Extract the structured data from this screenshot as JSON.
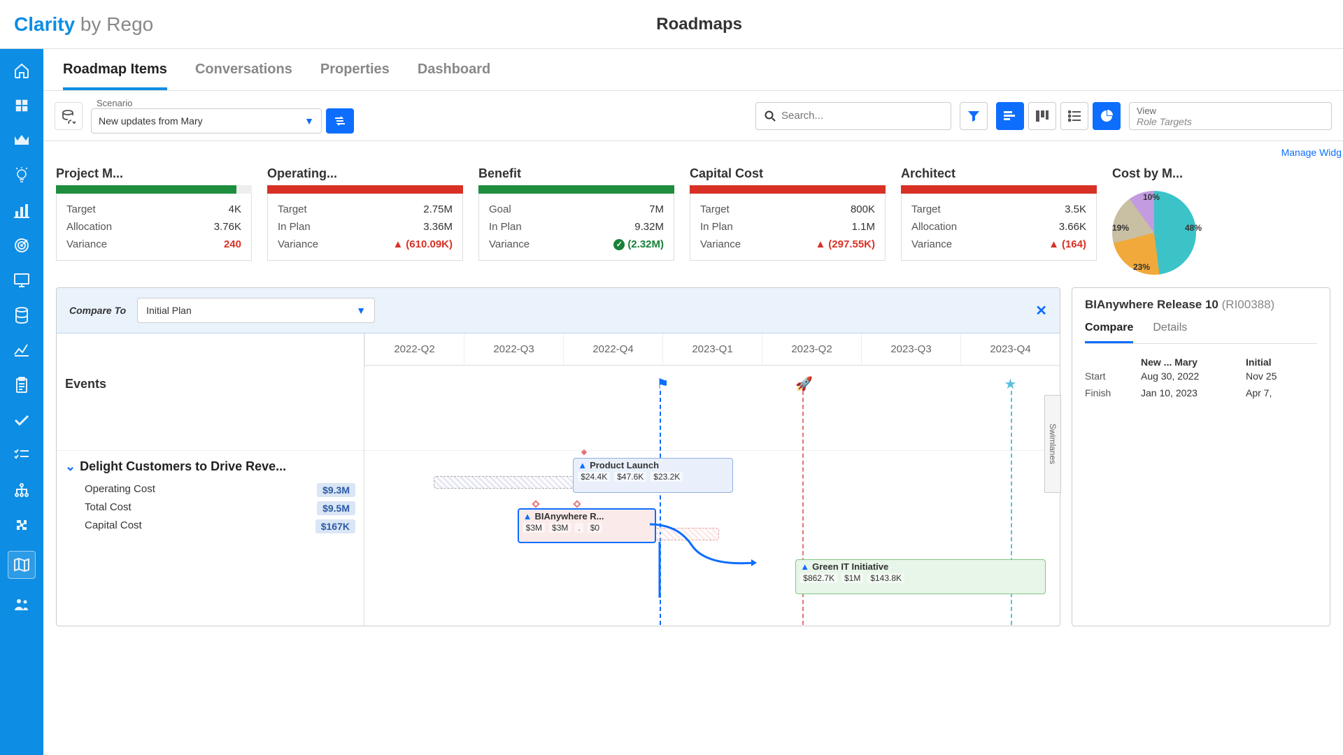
{
  "header": {
    "brand": "Clarity",
    "by": " by Rego",
    "title": "Roadmaps"
  },
  "tabs": [
    "Roadmap Items",
    "Conversations",
    "Properties",
    "Dashboard"
  ],
  "scenario": {
    "label": "Scenario",
    "value": "New updates from Mary"
  },
  "search": {
    "placeholder": "Search..."
  },
  "view": {
    "label": "View",
    "value": "Role Targets"
  },
  "widgets_link": "Manage Widg",
  "kpis": [
    {
      "title": "Project M...",
      "bar": [
        [
          "#1e8e3e",
          92
        ],
        [
          "#eee",
          8
        ]
      ],
      "lines": [
        [
          "Target",
          "4K"
        ],
        [
          "Allocation",
          "3.76K"
        ],
        [
          "Variance",
          "240"
        ]
      ],
      "var_status": "none"
    },
    {
      "title": "Operating...",
      "bar": [
        [
          "#d93025",
          100
        ]
      ],
      "lines": [
        [
          "Target",
          "2.75M"
        ],
        [
          "In Plan",
          "3.36M"
        ],
        [
          "Variance",
          "(610.09K)"
        ]
      ],
      "var_status": "bad"
    },
    {
      "title": "Benefit",
      "bar": [
        [
          "#1e8e3e",
          100
        ]
      ],
      "lines": [
        [
          "Goal",
          "7M"
        ],
        [
          "In Plan",
          "9.32M"
        ],
        [
          "Variance",
          "(2.32M)"
        ]
      ],
      "var_status": "good"
    },
    {
      "title": "Capital Cost",
      "bar": [
        [
          "#d93025",
          100
        ]
      ],
      "lines": [
        [
          "Target",
          "800K"
        ],
        [
          "In Plan",
          "1.1M"
        ],
        [
          "Variance",
          "(297.55K)"
        ]
      ],
      "var_status": "bad"
    },
    {
      "title": "Architect",
      "bar": [
        [
          "#d93025",
          100
        ]
      ],
      "lines": [
        [
          "Target",
          "3.5K"
        ],
        [
          "Allocation",
          "3.66K"
        ],
        [
          "Variance",
          "(164)"
        ]
      ],
      "var_status": "bad"
    }
  ],
  "pie": {
    "title": "Cost by M...",
    "slices": [
      {
        "l": "48%"
      },
      {
        "l": "23%"
      },
      {
        "l": "19%"
      },
      {
        "l": "10%"
      }
    ]
  },
  "compare": {
    "label": "Compare To",
    "value": "Initial Plan"
  },
  "timeline": {
    "quarters": [
      "2022-Q2",
      "2022-Q3",
      "2022-Q4",
      "2023-Q1",
      "2023-Q2",
      "2023-Q3",
      "2023-Q4"
    ],
    "events_label": "Events",
    "swimlanes": "Swimlanes"
  },
  "group": {
    "title": "Delight Customers to Drive Reve...",
    "metrics": [
      [
        "Operating Cost",
        "$9.3M"
      ],
      [
        "Total Cost",
        "$9.5M"
      ],
      [
        "Capital Cost",
        "$167K"
      ]
    ],
    "bars": {
      "product_launch": {
        "title": "Product Launch",
        "costs": [
          "$24.4K",
          "$47.6K",
          "$23.2K"
        ]
      },
      "bianywhere": {
        "title": "BIAnywhere R...",
        "costs": [
          "$3M",
          "$3M",
          "$0"
        ]
      },
      "green_it": {
        "title": "Green IT Initiative",
        "costs": [
          "$862.7K",
          "$1M",
          "$143.8K"
        ]
      }
    }
  },
  "detail": {
    "name": "BIAnywhere Release 10",
    "code": "(RI00388)",
    "tabs": [
      "Compare",
      "Details"
    ],
    "cols": [
      "New ... Mary",
      "Initial"
    ],
    "rows": [
      {
        "k": "Start",
        "a": "Aug 30, 2022",
        "b": "Nov 25"
      },
      {
        "k": "Finish",
        "a": "Jan 10, 2023",
        "b": "Apr 7,"
      }
    ]
  },
  "chart_data": {
    "type": "pie",
    "title": "Cost by M...",
    "series": [
      {
        "name": "slice-a",
        "value": 48,
        "color": "#3cc3c8"
      },
      {
        "name": "slice-b",
        "value": 23,
        "color": "#f2a93b"
      },
      {
        "name": "slice-c",
        "value": 19,
        "color": "#c9bfa3"
      },
      {
        "name": "slice-d",
        "value": 10,
        "color": "#c39be0"
      }
    ]
  }
}
